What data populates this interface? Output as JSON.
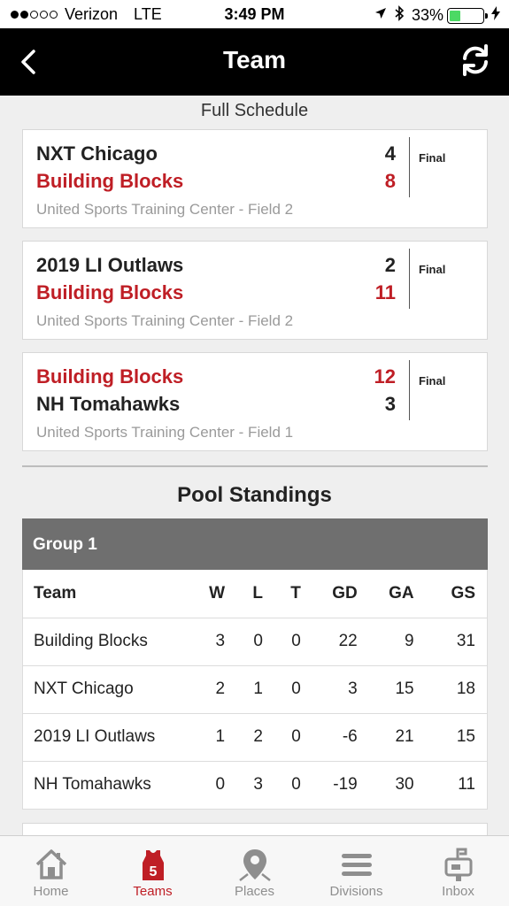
{
  "status_bar": {
    "carrier": "Verizon",
    "network": "LTE",
    "time": "3:49 PM",
    "battery": "33%",
    "battery_level": 0.33,
    "signal_bars": 2,
    "signal_total": 5
  },
  "nav": {
    "title": "Team",
    "back_icon": "chevron-left-icon",
    "refresh_icon": "refresh-icon"
  },
  "schedule": {
    "link_label": "Full Schedule",
    "games": [
      {
        "team_top": "NXT Chicago",
        "score_top": "4",
        "team_bottom": "Building Blocks",
        "score_bottom": "8",
        "venue": "United Sports Training Center - Field 2",
        "status": "Final"
      },
      {
        "team_top": "2019 LI Outlaws",
        "score_top": "2",
        "team_bottom": "Building Blocks",
        "score_bottom": "11",
        "venue": "United Sports Training Center - Field 2",
        "status": "Final"
      },
      {
        "team_top": "Building Blocks",
        "score_top": "12",
        "team_bottom": "NH Tomahawks",
        "score_bottom": "3",
        "venue": "United Sports Training Center - Field 1",
        "status": "Final"
      }
    ]
  },
  "standings": {
    "title": "Pool Standings",
    "group_name": "Group 1",
    "columns": [
      "Team",
      "W",
      "L",
      "T",
      "GD",
      "GA",
      "GS"
    ],
    "rows": [
      [
        "Building Blocks",
        "3",
        "0",
        "0",
        "22",
        "9",
        "31"
      ],
      [
        "NXT Chicago",
        "2",
        "1",
        "0",
        "3",
        "15",
        "18"
      ],
      [
        "2019 LI Outlaws",
        "1",
        "2",
        "0",
        "-6",
        "21",
        "15"
      ],
      [
        "NH Tomahawks",
        "0",
        "3",
        "0",
        "-19",
        "30",
        "11"
      ]
    ]
  },
  "tabs": [
    {
      "label": "Home",
      "icon": "home-icon",
      "active": false
    },
    {
      "label": "Teams",
      "icon": "jersey-icon",
      "badge": "5",
      "active": true
    },
    {
      "label": "Places",
      "icon": "map-pin-icon",
      "active": false
    },
    {
      "label": "Divisions",
      "icon": "menu-bars-icon",
      "active": false
    },
    {
      "label": "Inbox",
      "icon": "mailbox-icon",
      "active": false
    }
  ],
  "colors": {
    "accent": "#bf1e25",
    "nav_bg": "#000000",
    "group_header_bg": "#6f6f6f",
    "battery": "#4cd964"
  }
}
